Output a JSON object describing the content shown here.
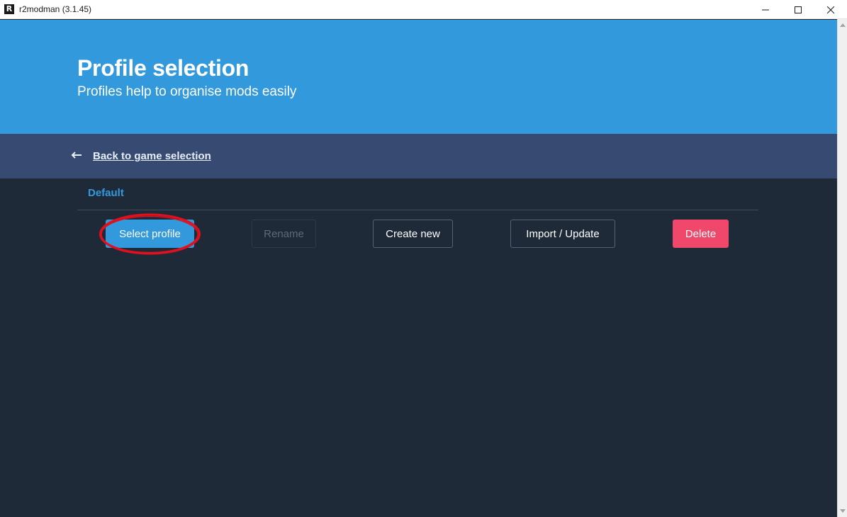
{
  "window": {
    "title": "r2modman (3.1.45)",
    "logo_letter": "R"
  },
  "hero": {
    "title": "Profile selection",
    "subtitle": "Profiles help to organise mods easily"
  },
  "nav": {
    "back_label": "Back to game selection"
  },
  "profiles": {
    "selected_name": "Default"
  },
  "actions": {
    "select_label": "Select profile",
    "rename_label": "Rename",
    "create_label": "Create new",
    "import_label": "Import / Update",
    "delete_label": "Delete"
  },
  "colors": {
    "hero_bg": "#3399dd",
    "backbar_bg": "#364a72",
    "main_bg": "#1f2a38",
    "delete_bg": "#f0486a",
    "annotation_red": "#e0101e"
  }
}
